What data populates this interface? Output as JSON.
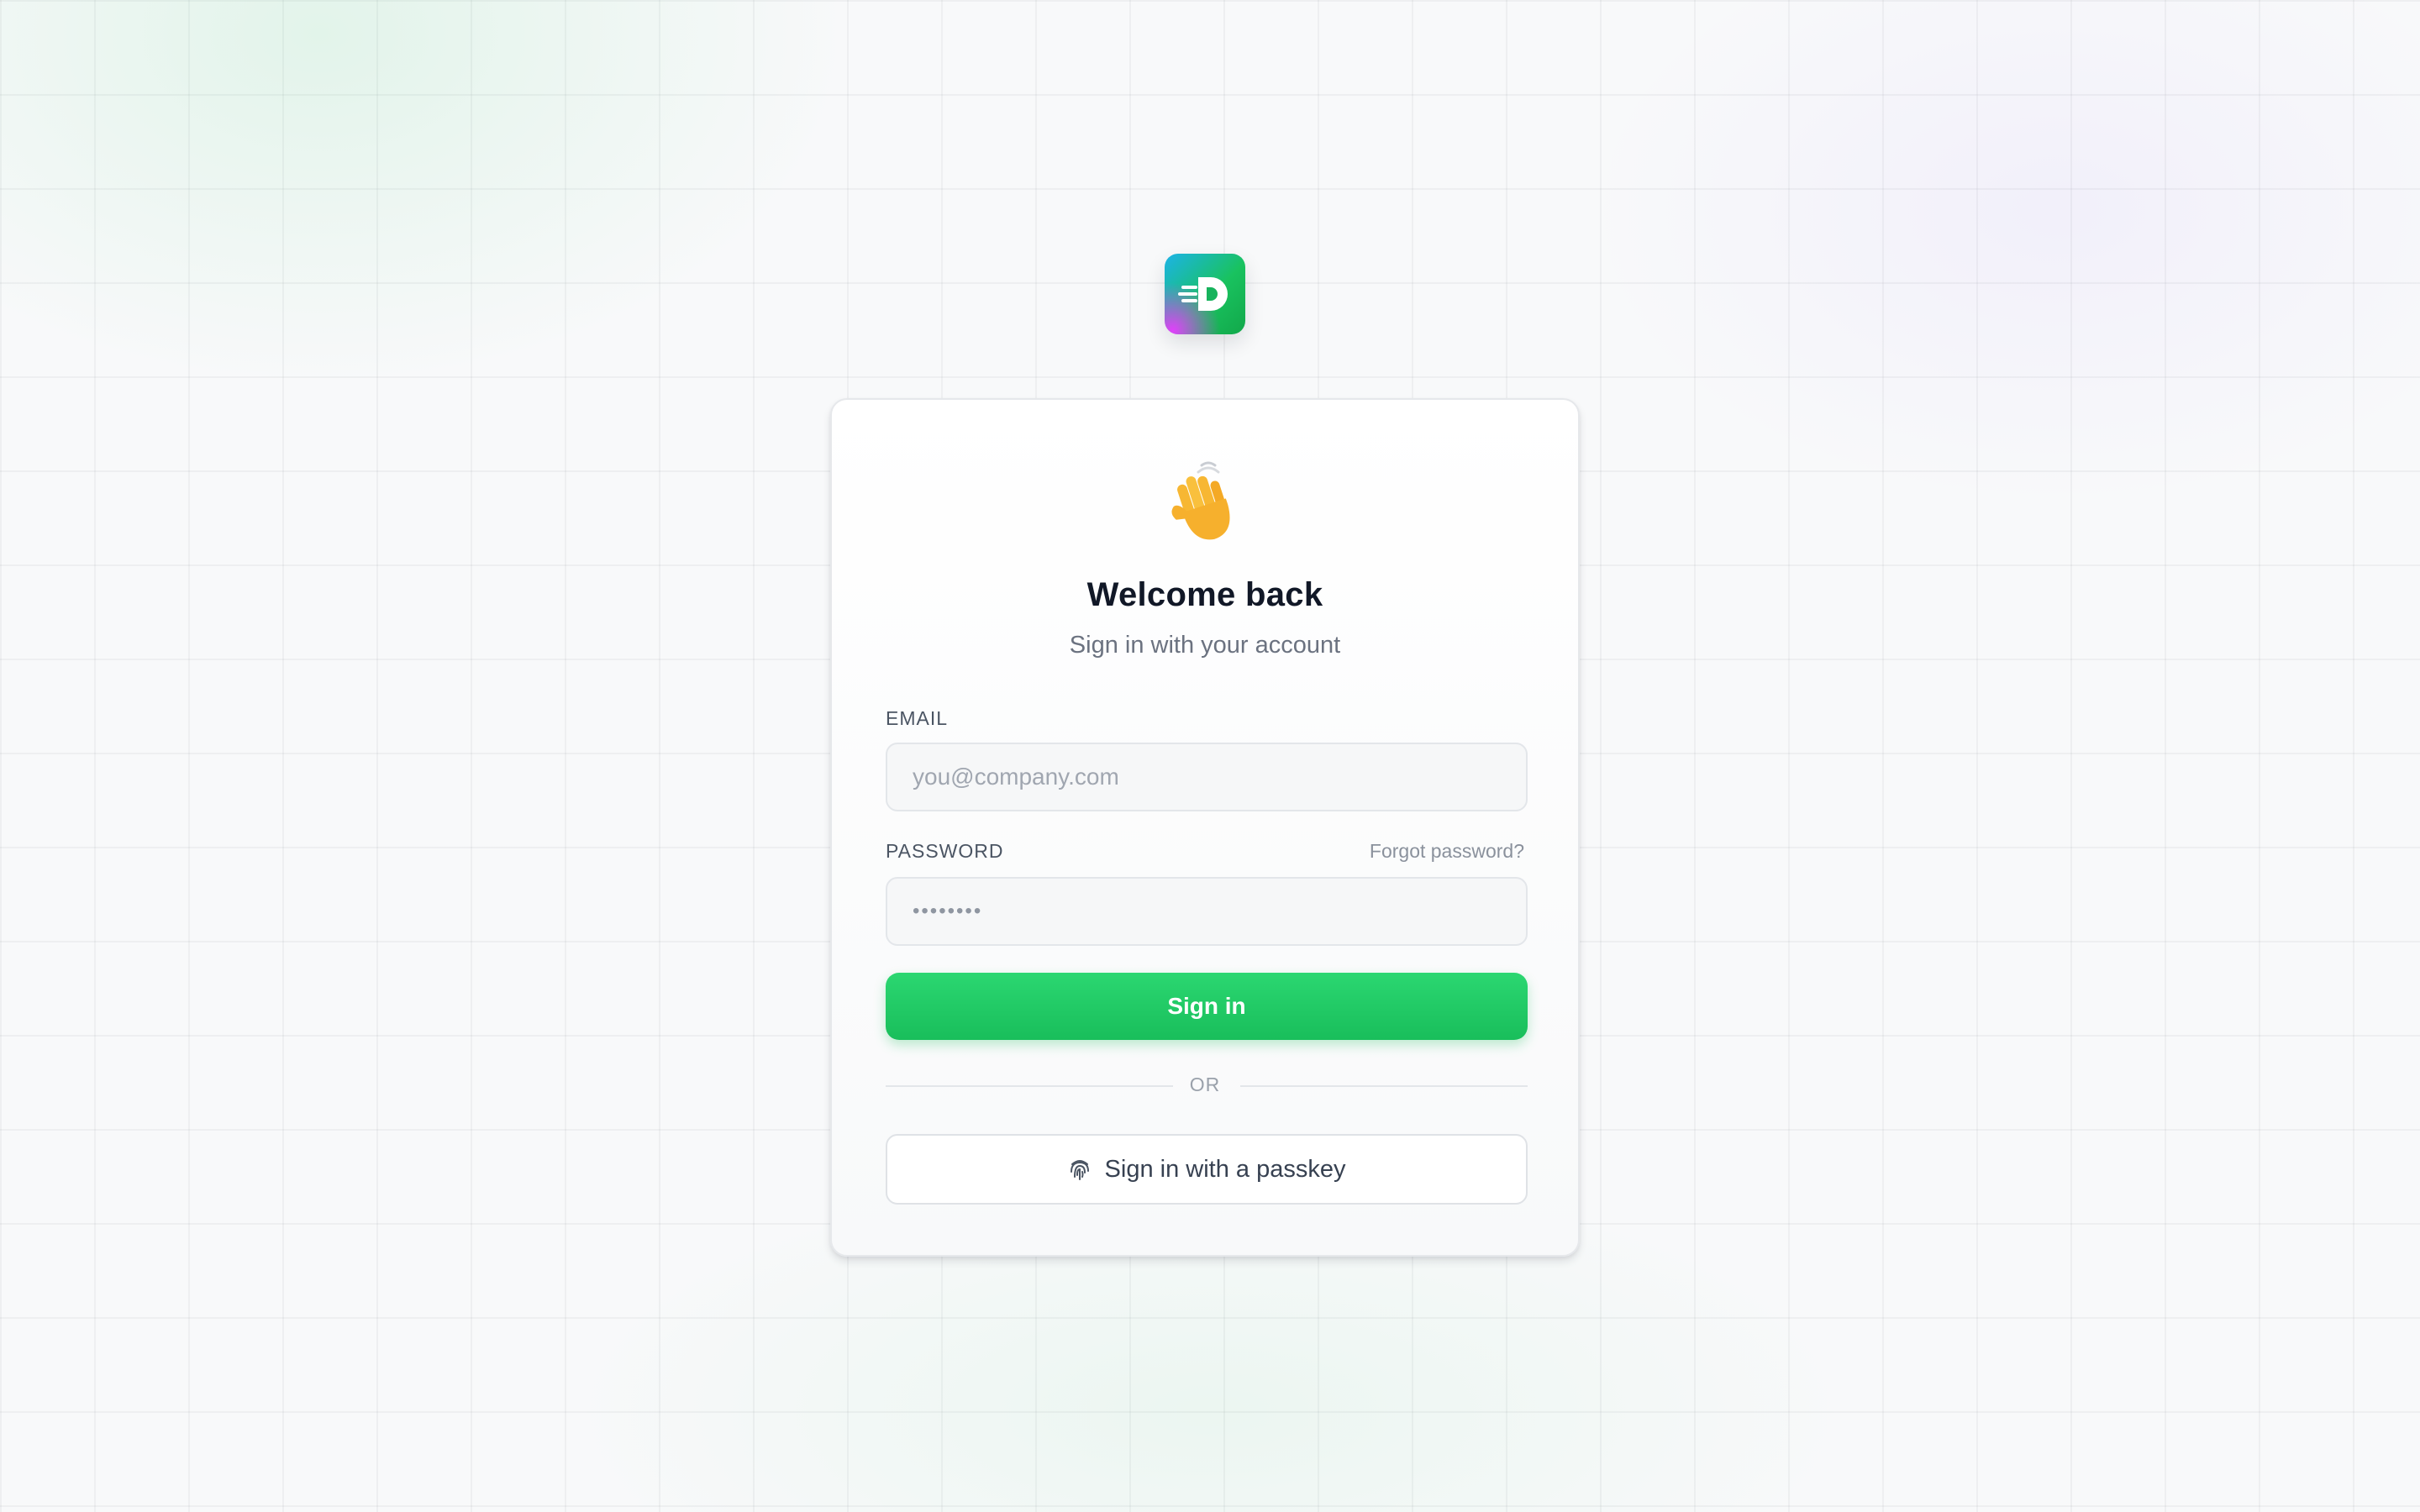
{
  "brand": {
    "logo_icon": "d-logo-icon",
    "logo_letter": "D",
    "colors": {
      "primary": "#19be5b",
      "logo_blue": "#1cb3e8",
      "logo_magenta": "#e040fb"
    }
  },
  "card": {
    "emoji_icon": "waving-hand-icon",
    "title": "Welcome back",
    "subtitle": "Sign in with your account",
    "email": {
      "label": "EMAIL",
      "placeholder": "you@company.com",
      "value": ""
    },
    "password": {
      "label": "PASSWORD",
      "forgot_link": "Forgot password?",
      "masked_value": "••••••••"
    },
    "sign_in_button": "Sign in",
    "divider": "OR",
    "passkey": {
      "icon": "fingerprint-icon",
      "label": "Sign in with a passkey"
    }
  }
}
